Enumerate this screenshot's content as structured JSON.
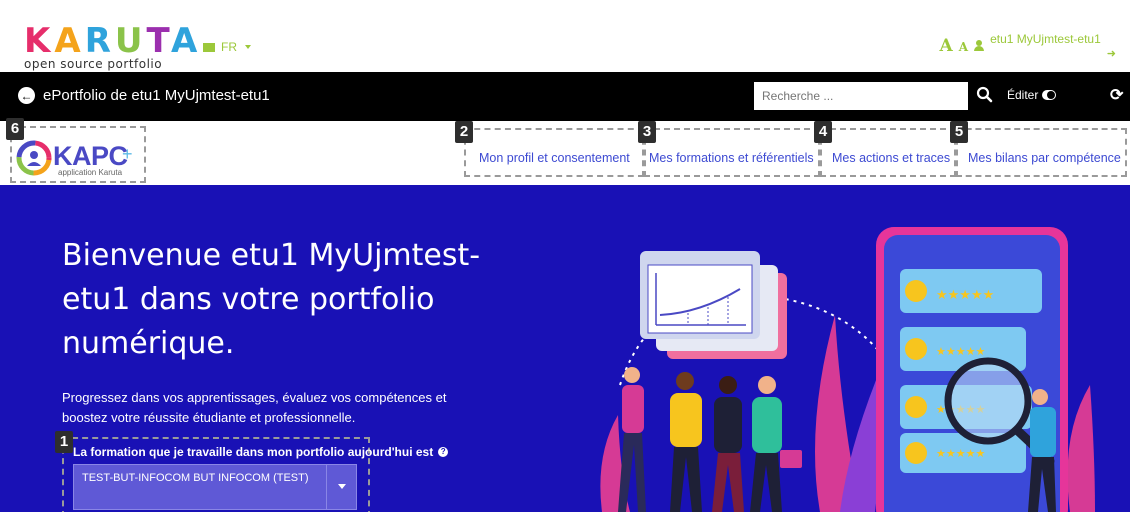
{
  "brand": {
    "letters": [
      "K",
      "A",
      "R",
      "U",
      "T",
      "A"
    ],
    "subtitle": "open source portfolio"
  },
  "header": {
    "language": "FR",
    "font_increase": "A",
    "font_decrease": "A",
    "username": "etu1 MyUjmtest-etu1"
  },
  "navbar": {
    "title": "ePortfolio de etu1 MyUjmtest-etu1",
    "search_placeholder": "Recherche ...",
    "edit_label": "Éditer"
  },
  "app_logo": {
    "name": "KAPC",
    "plus": "+",
    "subtitle": "application Karuta"
  },
  "subnav": {
    "badges": [
      "1",
      "2",
      "3",
      "4",
      "5",
      "6"
    ],
    "links": [
      "Mon profil et consentement",
      "Mes formations et référentiels",
      "Mes actions et traces",
      "Mes bilans par compétence"
    ]
  },
  "hero": {
    "title": "Bienvenue etu1 MyUjmtest-etu1 dans votre portfolio numérique.",
    "text": "Progressez dans vos apprentissages, évaluez vos compétences et boostez votre réussite étudiante et professionnelle.",
    "formation_label": "La formation que je travaille dans mon portfolio aujourd'hui est",
    "formation_value": "TEST-BUT-INFOCOM BUT INFOCOM (TEST)"
  },
  "colors": {
    "hero_bg": "#1911b5",
    "link": "#3d4ad2",
    "accent_green": "#9cc83a"
  },
  "icons": [
    "envelope-icon",
    "user-icon",
    "logout-icon",
    "back-arrow-icon",
    "search-icon",
    "toggle-icon",
    "refresh-icon",
    "help-icon",
    "chevron-down-icon"
  ]
}
